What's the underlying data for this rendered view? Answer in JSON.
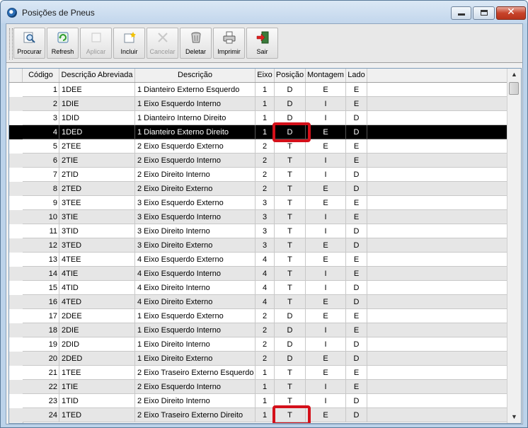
{
  "window": {
    "title": "Posições de Pneus",
    "minimize_icon": "minimize-icon",
    "maximize_icon": "maximize-icon",
    "close_glyph": "✕"
  },
  "toolbar": {
    "buttons": [
      {
        "label": "Procurar",
        "icon": "search-icon",
        "enabled": true
      },
      {
        "label": "Refresh",
        "icon": "refresh-icon",
        "enabled": true
      },
      {
        "label": "Aplicar",
        "icon": "apply-icon",
        "enabled": false
      },
      {
        "label": "Incluir",
        "icon": "add-icon",
        "enabled": true
      },
      {
        "label": "Cancelar",
        "icon": "cancel-icon",
        "enabled": false
      },
      {
        "label": "Deletar",
        "icon": "trash-icon",
        "enabled": true
      },
      {
        "label": "Imprimir",
        "icon": "printer-icon",
        "enabled": true
      },
      {
        "label": "Sair",
        "icon": "exit-icon",
        "enabled": true
      }
    ]
  },
  "grid": {
    "columns": [
      "Código",
      "Descrição Abreviada",
      "Descrição",
      "Eixo",
      "Posição",
      "Montagem",
      "Lado"
    ],
    "selected_row_index": 3,
    "highlighted_cells": [
      {
        "row": 3,
        "column": "Posição"
      },
      {
        "row": 23,
        "column": "Posição"
      }
    ],
    "rows": [
      [
        "1",
        "1DEE",
        "1 Dianteiro Externo Esquerdo",
        "1",
        "D",
        "E",
        "E"
      ],
      [
        "2",
        "1DIE",
        "1 Eixo Esquerdo Interno",
        "1",
        "D",
        "I",
        "E"
      ],
      [
        "3",
        "1DID",
        "1 Dianteiro Interno Direito",
        "1",
        "D",
        "I",
        "D"
      ],
      [
        "4",
        "1DED",
        "1 Dianteiro Externo Direito",
        "1",
        "D",
        "E",
        "D"
      ],
      [
        "5",
        "2TEE",
        "2 Eixo Esquerdo Externo",
        "2",
        "T",
        "E",
        "E"
      ],
      [
        "6",
        "2TIE",
        "2 Eixo Esquerdo Interno",
        "2",
        "T",
        "I",
        "E"
      ],
      [
        "7",
        "2TID",
        "2 Eixo Direito Interno",
        "2",
        "T",
        "I",
        "D"
      ],
      [
        "8",
        "2TED",
        "2 Eixo Direito Externo",
        "2",
        "T",
        "E",
        "D"
      ],
      [
        "9",
        "3TEE",
        "3 Eixo Esquerdo Externo",
        "3",
        "T",
        "E",
        "E"
      ],
      [
        "10",
        "3TIE",
        "3 Eixo Esquerdo Interno",
        "3",
        "T",
        "I",
        "E"
      ],
      [
        "11",
        "3TID",
        "3 Eixo Direito Interno",
        "3",
        "T",
        "I",
        "D"
      ],
      [
        "12",
        "3TED",
        "3 Eixo Direito Externo",
        "3",
        "T",
        "E",
        "D"
      ],
      [
        "13",
        "4TEE",
        "4 Eixo Esquerdo Externo",
        "4",
        "T",
        "E",
        "E"
      ],
      [
        "14",
        "4TIE",
        "4 Eixo Esquerdo Interno",
        "4",
        "T",
        "I",
        "E"
      ],
      [
        "15",
        "4TID",
        "4 Eixo Direito Interno",
        "4",
        "T",
        "I",
        "D"
      ],
      [
        "16",
        "4TED",
        "4 Eixo Direito Externo",
        "4",
        "T",
        "E",
        "D"
      ],
      [
        "17",
        "2DEE",
        "1 Eixo Esquerdo Externo",
        "2",
        "D",
        "E",
        "E"
      ],
      [
        "18",
        "2DIE",
        "1 Eixo Esquerdo Interno",
        "2",
        "D",
        "I",
        "E"
      ],
      [
        "19",
        "2DID",
        "1 Eixo Direito Interno",
        "2",
        "D",
        "I",
        "D"
      ],
      [
        "20",
        "2DED",
        "1 Eixo Direito Externo",
        "2",
        "D",
        "E",
        "D"
      ],
      [
        "21",
        "1TEE",
        "2 Eixo Traseiro Externo Esquerdo",
        "1",
        "T",
        "E",
        "E"
      ],
      [
        "22",
        "1TIE",
        "2 Eixo Esquerdo Interno",
        "1",
        "T",
        "I",
        "E"
      ],
      [
        "23",
        "1TID",
        "2 Eixo Direito Interno",
        "1",
        "T",
        "I",
        "D"
      ],
      [
        "24",
        "1TED",
        "2 Eixo Traseiro Externo Direito",
        "1",
        "T",
        "E",
        "D"
      ]
    ]
  },
  "colors": {
    "title_bar": "#c2d6ec",
    "close_button": "#c7432a",
    "selected_row": "#000000",
    "highlight_border": "#d4101a",
    "even_row": "#e6e6e6"
  }
}
